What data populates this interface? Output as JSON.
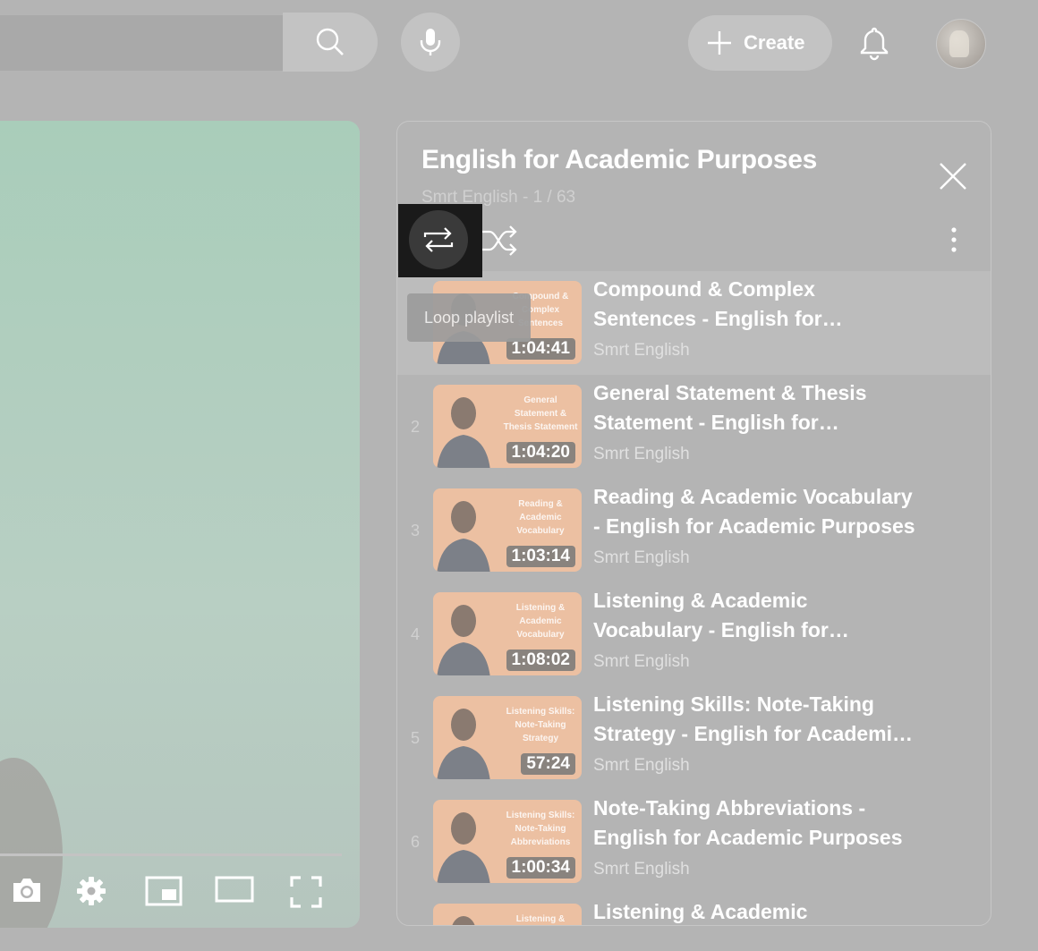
{
  "header": {
    "search_icon": "search-icon",
    "mic_icon": "microphone-icon",
    "create_label": "Create",
    "bell_icon": "bell-icon"
  },
  "player": {
    "controls": [
      "camera-icon",
      "settings-icon",
      "miniplayer-icon",
      "theater-mode-icon",
      "fullscreen-icon"
    ]
  },
  "playlist": {
    "title": "English for Academic Purposes",
    "subtitle": "Smrt English - 1 / 63",
    "loop_tooltip": "Loop playlist",
    "items": [
      {
        "index": "",
        "title": "Compound & Complex Sentences - English for Academic Purposes",
        "channel": "Smrt English",
        "duration": "1:04:41",
        "thumb_text": "Compound & Complex Sentences"
      },
      {
        "index": "2",
        "title": "General Statement & Thesis Statement - English for Academic Purposes",
        "channel": "Smrt English",
        "duration": "1:04:20",
        "thumb_text": "General Statement & Thesis Statement"
      },
      {
        "index": "3",
        "title": "Reading & Academic Vocabulary - English for Academic Purposes",
        "channel": "Smrt English",
        "duration": "1:03:14",
        "thumb_text": "Reading & Academic Vocabulary"
      },
      {
        "index": "4",
        "title": "Listening & Academic Vocabulary - English for Academic Purposes",
        "channel": "Smrt English",
        "duration": "1:08:02",
        "thumb_text": "Listening & Academic Vocabulary"
      },
      {
        "index": "5",
        "title": "Listening Skills: Note-Taking Strategy - English for Academic Purposes",
        "channel": "Smrt English",
        "duration": "57:24",
        "thumb_text": "Listening Skills: Note-Taking Strategy"
      },
      {
        "index": "6",
        "title": "Note-Taking Abbreviations - English for Academic Purposes",
        "channel": "Smrt English",
        "duration": "1:00:34",
        "thumb_text": "Listening Skills: Note-Taking Abbreviations"
      },
      {
        "index": "",
        "title": "Listening & Academic Vocabulary",
        "channel": "",
        "duration": "",
        "thumb_text": "Listening &"
      }
    ]
  }
}
